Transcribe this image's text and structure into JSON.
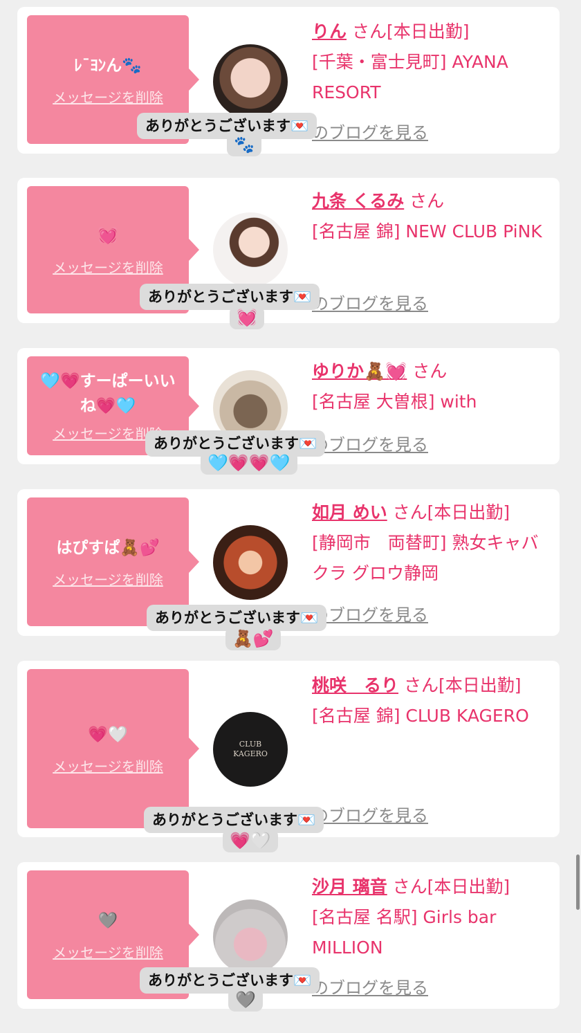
{
  "colors": {
    "accent": "#e8336b",
    "bubble": "#f4879f",
    "toast": "#dcdcdc"
  },
  "cards": [
    {
      "message": "ﾚ¯ﾖﾝん🐾",
      "delete_label": "メッセージを削除",
      "name": "りん",
      "san": "さん[本日出勤]",
      "shop": "[千葉・富士見町] AYANA RESORT",
      "blog_label": "のブログを見る",
      "toast_text": "ありがとうございます💌",
      "toast_emoji": "🐾"
    },
    {
      "message": "💓",
      "delete_label": "メッセージを削除",
      "name": "九条 くるみ",
      "san": "さん",
      "shop": "[名古屋 錦] NEW CLUB PiNK",
      "blog_label": "のブログを見る",
      "toast_text": "ありがとうございます💌",
      "toast_emoji": "💓"
    },
    {
      "message": "🩵💗すーぱーいいね💗🩵",
      "delete_label": "メッセージを削除",
      "name": "ゆりか🧸💓",
      "san": "さん",
      "shop": "[名古屋 大曽根] with",
      "blog_label": "のブログを見る",
      "toast_text": "ありがとうございます💌",
      "toast_emoji": "🩵💗💗🩵"
    },
    {
      "message": "はぴすぱ🧸💕",
      "delete_label": "メッセージを削除",
      "name": "如月 めい",
      "san": "さん[本日出勤]",
      "shop": "[静岡市　両替町] 熟女キャバクラ グロウ静岡",
      "blog_label": "のブログを見る",
      "toast_text": "ありがとうございます💌",
      "toast_emoji": "🧸💕"
    },
    {
      "message": "💗🤍",
      "delete_label": "メッセージを削除",
      "name": "桃咲　るり",
      "san": "さん[本日出勤]",
      "shop": "[名古屋 錦] CLUB KAGERO",
      "blog_label": "のブログを見る",
      "toast_text": "ありがとうございます💌",
      "toast_emoji": "💗🤍",
      "avatar_text": "CLUB KAGERO"
    },
    {
      "message": "🩶",
      "delete_label": "メッセージを削除",
      "name": "沙月 璃音",
      "san": "さん[本日出勤]",
      "shop": "[名古屋 名駅] Girls bar MILLION",
      "blog_label": "のブログを見る",
      "toast_text": "ありがとうございます💌",
      "toast_emoji": "🩶"
    }
  ]
}
